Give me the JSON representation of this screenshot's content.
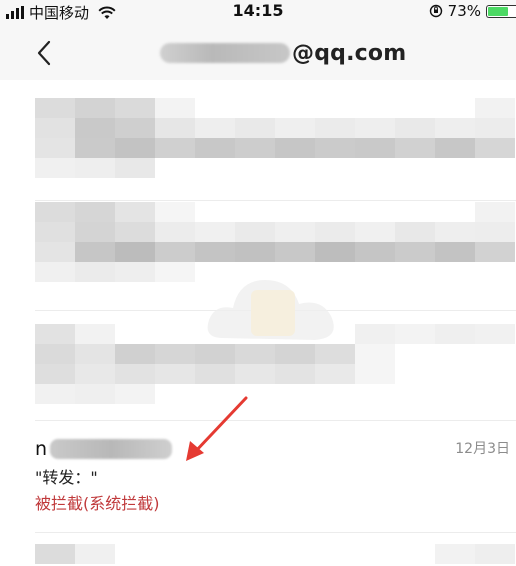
{
  "status_bar": {
    "carrier": "中国移动",
    "time": "14:15",
    "battery_percent": "73%",
    "battery_level": 0.73
  },
  "header": {
    "title_suffix": "@qq.com",
    "back_icon": "chevron-left-icon"
  },
  "mail_items": [
    {
      "sender_visible": "n",
      "date": "12月3日",
      "subject": "\"转发：\"",
      "status": "被拦截(系统拦截)"
    }
  ],
  "colors": {
    "status_red": "#c0393b",
    "battery_green": "#4cd964",
    "date_gray": "#8c8c8c"
  }
}
